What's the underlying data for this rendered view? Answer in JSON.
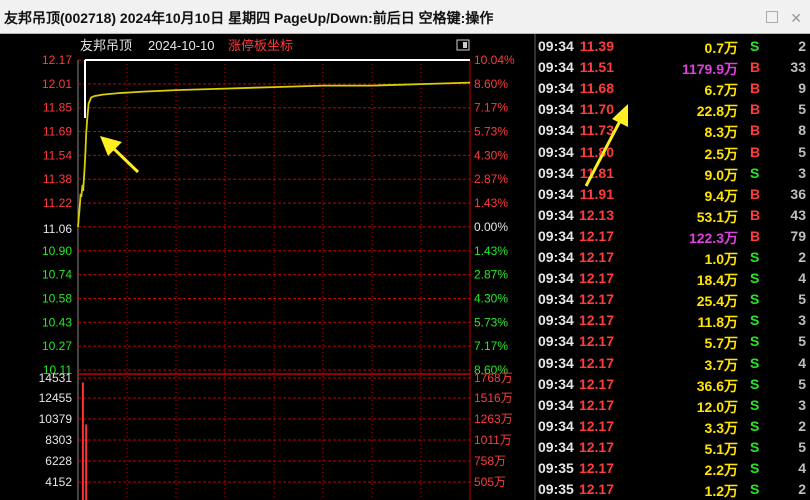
{
  "window": {
    "title": "友邦吊顶(002718) 2024年10月10日 星期四 PageUp/Down:前后日 空格键:操作"
  },
  "chart": {
    "stock_name": "友邦吊顶",
    "date": "2024-10-10",
    "mode_label": "涨停板坐标",
    "prev_close": 11.06,
    "price_axis": {
      "up_prices": [
        "12.17",
        "12.01",
        "11.85",
        "11.69",
        "11.54",
        "11.38",
        "11.22"
      ],
      "mid_price": "11.06",
      "down_prices": [
        "10.90",
        "10.74",
        "10.58",
        "10.43",
        "10.27",
        "10.11"
      ],
      "up_pcts": [
        "10.04%",
        "8.60%",
        "7.17%",
        "5.73%",
        "4.30%",
        "2.87%",
        "1.43%"
      ],
      "mid_pct": "0.00%",
      "down_pcts": [
        "1.43%",
        "2.87%",
        "4.30%",
        "5.73%",
        "7.17%",
        "8.60%"
      ]
    },
    "volume_axis": {
      "left": [
        "14531",
        "12455",
        "10379",
        "8303",
        "6228",
        "4152"
      ],
      "right": [
        "1768万",
        "1516万",
        "1263万",
        "1011万",
        "758万",
        "505万"
      ]
    },
    "chart_data": {
      "type": "line",
      "price_series": [
        [
          0,
          11.06
        ],
        [
          0.4,
          11.12
        ],
        [
          0.8,
          11.16
        ],
        [
          1.2,
          11.22
        ],
        [
          1.6,
          11.28
        ],
        [
          2.0,
          11.26
        ],
        [
          2.4,
          11.3
        ],
        [
          2.8,
          11.34
        ],
        [
          3.2,
          11.3
        ],
        [
          3.6,
          11.38
        ],
        [
          4.0,
          11.44
        ],
        [
          4.5,
          11.54
        ],
        [
          5.0,
          11.68
        ],
        [
          5.5,
          11.76
        ],
        [
          6.5,
          11.88
        ],
        [
          8,
          11.92
        ],
        [
          10,
          11.93
        ],
        [
          15,
          11.94
        ],
        [
          25,
          11.95
        ],
        [
          40,
          11.96
        ],
        [
          60,
          11.97
        ],
        [
          90,
          11.98
        ],
        [
          120,
          11.99
        ],
        [
          150,
          12.0
        ],
        [
          180,
          12.0
        ],
        [
          210,
          12.01
        ],
        [
          240,
          12.02
        ]
      ],
      "volume_series": [
        [
          3,
          14000
        ],
        [
          5,
          9000
        ]
      ],
      "x_range": [
        0,
        240
      ],
      "price_range": [
        10.11,
        12.17
      ]
    },
    "annotations": [
      "arrow-left-chart",
      "arrow-right-ticks"
    ]
  },
  "ticks": [
    {
      "time": "09:34",
      "price": "11.39",
      "vol": "0.7万",
      "dir": "S",
      "count": "2",
      "big": false
    },
    {
      "time": "09:34",
      "price": "11.51",
      "vol": "1179.9万",
      "dir": "B",
      "count": "33",
      "big": true
    },
    {
      "time": "09:34",
      "price": "11.68",
      "vol": "6.7万",
      "dir": "B",
      "count": "9",
      "big": false
    },
    {
      "time": "09:34",
      "price": "11.70",
      "vol": "22.8万",
      "dir": "B",
      "count": "5",
      "big": false
    },
    {
      "time": "09:34",
      "price": "11.73",
      "vol": "8.3万",
      "dir": "B",
      "count": "8",
      "big": false
    },
    {
      "time": "09:34",
      "price": "11.80",
      "vol": "2.5万",
      "dir": "B",
      "count": "5",
      "big": false
    },
    {
      "time": "09:34",
      "price": "11.81",
      "vol": "9.0万",
      "dir": "S",
      "count": "3",
      "big": false
    },
    {
      "time": "09:34",
      "price": "11.91",
      "vol": "9.4万",
      "dir": "B",
      "count": "36",
      "big": false
    },
    {
      "time": "09:34",
      "price": "12.13",
      "vol": "53.1万",
      "dir": "B",
      "count": "43",
      "big": false
    },
    {
      "time": "09:34",
      "price": "12.17",
      "vol": "122.3万",
      "dir": "B",
      "count": "79",
      "big": true
    },
    {
      "time": "09:34",
      "price": "12.17",
      "vol": "1.0万",
      "dir": "S",
      "count": "2",
      "big": false
    },
    {
      "time": "09:34",
      "price": "12.17",
      "vol": "18.4万",
      "dir": "S",
      "count": "4",
      "big": false
    },
    {
      "time": "09:34",
      "price": "12.17",
      "vol": "25.4万",
      "dir": "S",
      "count": "5",
      "big": false
    },
    {
      "time": "09:34",
      "price": "12.17",
      "vol": "11.8万",
      "dir": "S",
      "count": "3",
      "big": false
    },
    {
      "time": "09:34",
      "price": "12.17",
      "vol": "5.7万",
      "dir": "S",
      "count": "5",
      "big": false
    },
    {
      "time": "09:34",
      "price": "12.17",
      "vol": "3.7万",
      "dir": "S",
      "count": "4",
      "big": false
    },
    {
      "time": "09:34",
      "price": "12.17",
      "vol": "36.6万",
      "dir": "S",
      "count": "5",
      "big": false
    },
    {
      "time": "09:34",
      "price": "12.17",
      "vol": "12.0万",
      "dir": "S",
      "count": "3",
      "big": false
    },
    {
      "time": "09:34",
      "price": "12.17",
      "vol": "3.3万",
      "dir": "S",
      "count": "2",
      "big": false
    },
    {
      "time": "09:34",
      "price": "12.17",
      "vol": "5.1万",
      "dir": "S",
      "count": "5",
      "big": false
    },
    {
      "time": "09:35",
      "price": "12.17",
      "vol": "2.2万",
      "dir": "S",
      "count": "4",
      "big": false
    },
    {
      "time": "09:35",
      "price": "12.17",
      "vol": "1.2万",
      "dir": "S",
      "count": "2",
      "big": false
    }
  ],
  "colors": {
    "grid": "#c40000",
    "up": "#ff3b3b",
    "down": "#25e825",
    "price_line": "#d8d000",
    "limit_line": "#ffffff",
    "volume_bar": "#ff3030",
    "arrow": "#ffee20",
    "big_volume": "#e040e0"
  }
}
